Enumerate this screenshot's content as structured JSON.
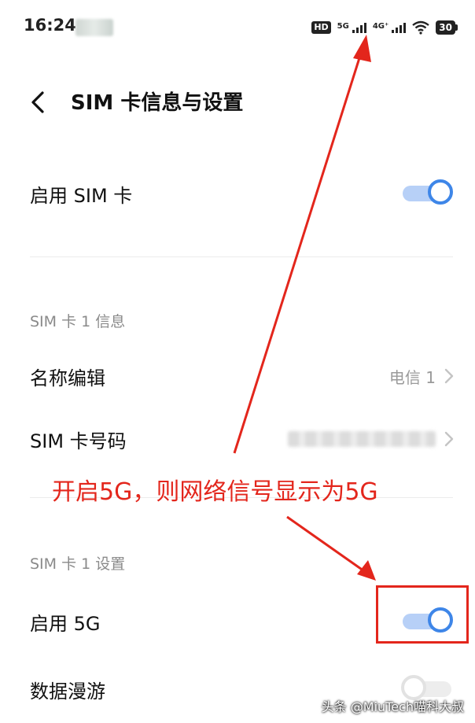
{
  "status_bar": {
    "time": "16:24",
    "hd_label": "HD",
    "sim1_network": "5G",
    "sim2_network": "4G⁺",
    "battery": "30"
  },
  "header": {
    "back_icon": "chevron-left-icon",
    "title": "SIM 卡信息与设置"
  },
  "enable_sim": {
    "label": "启用 SIM 卡",
    "enabled": true
  },
  "sim1_info": {
    "section_title": "SIM 卡 1 信息",
    "name_edit": {
      "label": "名称编辑",
      "value": "电信 1"
    },
    "phone_number": {
      "label": "SIM 卡号码",
      "value_masked": true
    }
  },
  "sim1_settings": {
    "section_title": "SIM 卡 1 设置",
    "enable_5g": {
      "label": "启用 5G",
      "enabled": true
    },
    "data_roaming": {
      "label": "数据漫游",
      "enabled": false
    }
  },
  "annotation": {
    "text": "开启5G，则网络信号显示为5G",
    "color": "#e3261c"
  },
  "colors": {
    "toggle_on": "#3e86e8",
    "toggle_on_track": "#b7d0f7",
    "toggle_off_track": "#ededed"
  },
  "watermark": "头条 @MiuTech喵科大叔"
}
